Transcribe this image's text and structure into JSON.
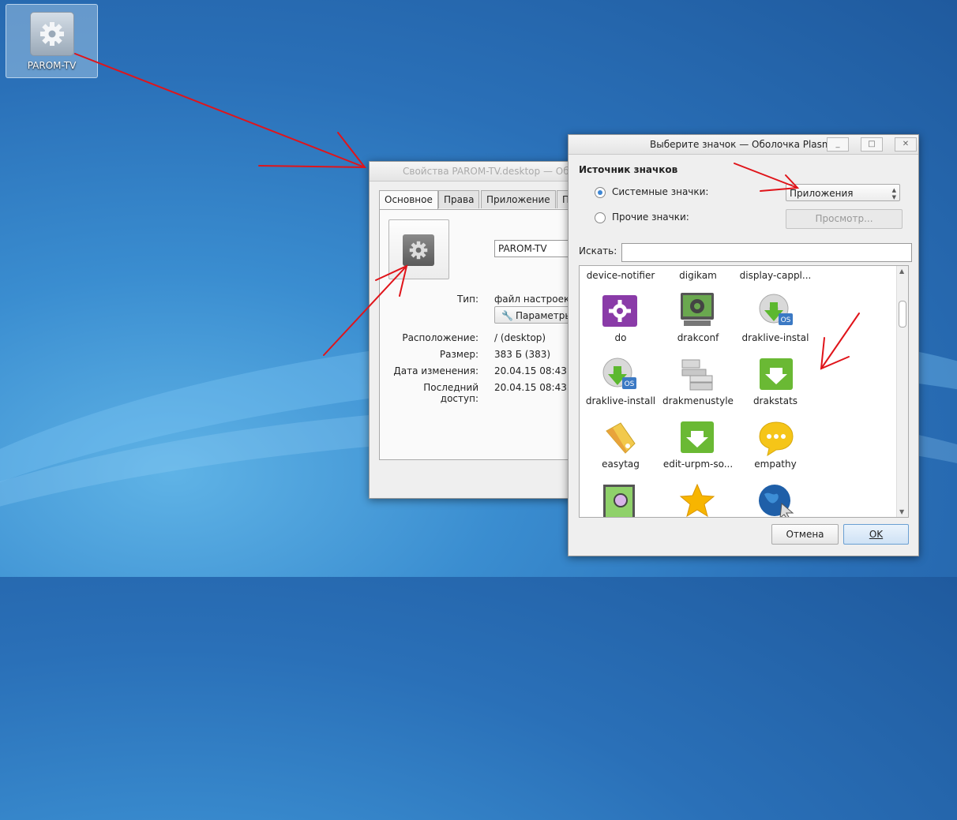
{
  "desktop": {
    "icon_label": "PAROM-TV"
  },
  "props_window": {
    "title": "Свойства PAROM-TV.desktop — Обо",
    "tabs": [
      {
        "label": "Основное",
        "active": true
      },
      {
        "label": "Права",
        "active": false
      },
      {
        "label": "Приложение",
        "active": false
      },
      {
        "label": "П",
        "active": false
      }
    ],
    "name_value": "PAROM-TV",
    "type_label": "Тип:",
    "type_value": "файл настроек р",
    "params_button": "Параметры",
    "location_label": "Расположение:",
    "location_value": "/ (desktop)",
    "size_label": "Размер:",
    "size_value": "383 Б (383)",
    "modified_label": "Дата изменения:",
    "modified_value": "20.04.15 08:43",
    "accessed_label": "Последний доступ:",
    "accessed_value": "20.04.15 08:43"
  },
  "chooser": {
    "title": "Выберите значок — Оболочка Plasma",
    "source_title": "Источник значков",
    "system_icons": "Системные значки:",
    "other_icons": "Прочие значки:",
    "category": "Приложения",
    "browse": "Просмотр...",
    "search_label": "Искать:",
    "search_value": "",
    "header_row": [
      "device-notifier",
      "digikam",
      "display-cappl..."
    ],
    "rows": [
      [
        "do",
        "drakconf",
        "draklive-instal"
      ],
      [
        "draklive-install",
        "drakmenustyle",
        "drakstats"
      ],
      [
        "easytag",
        "edit-urpm-so...",
        "empathy"
      ]
    ],
    "cancel": "Отмена",
    "ok": "OK"
  },
  "colors": {
    "accent": "#3d86d4",
    "annotation": "#e0141a"
  }
}
